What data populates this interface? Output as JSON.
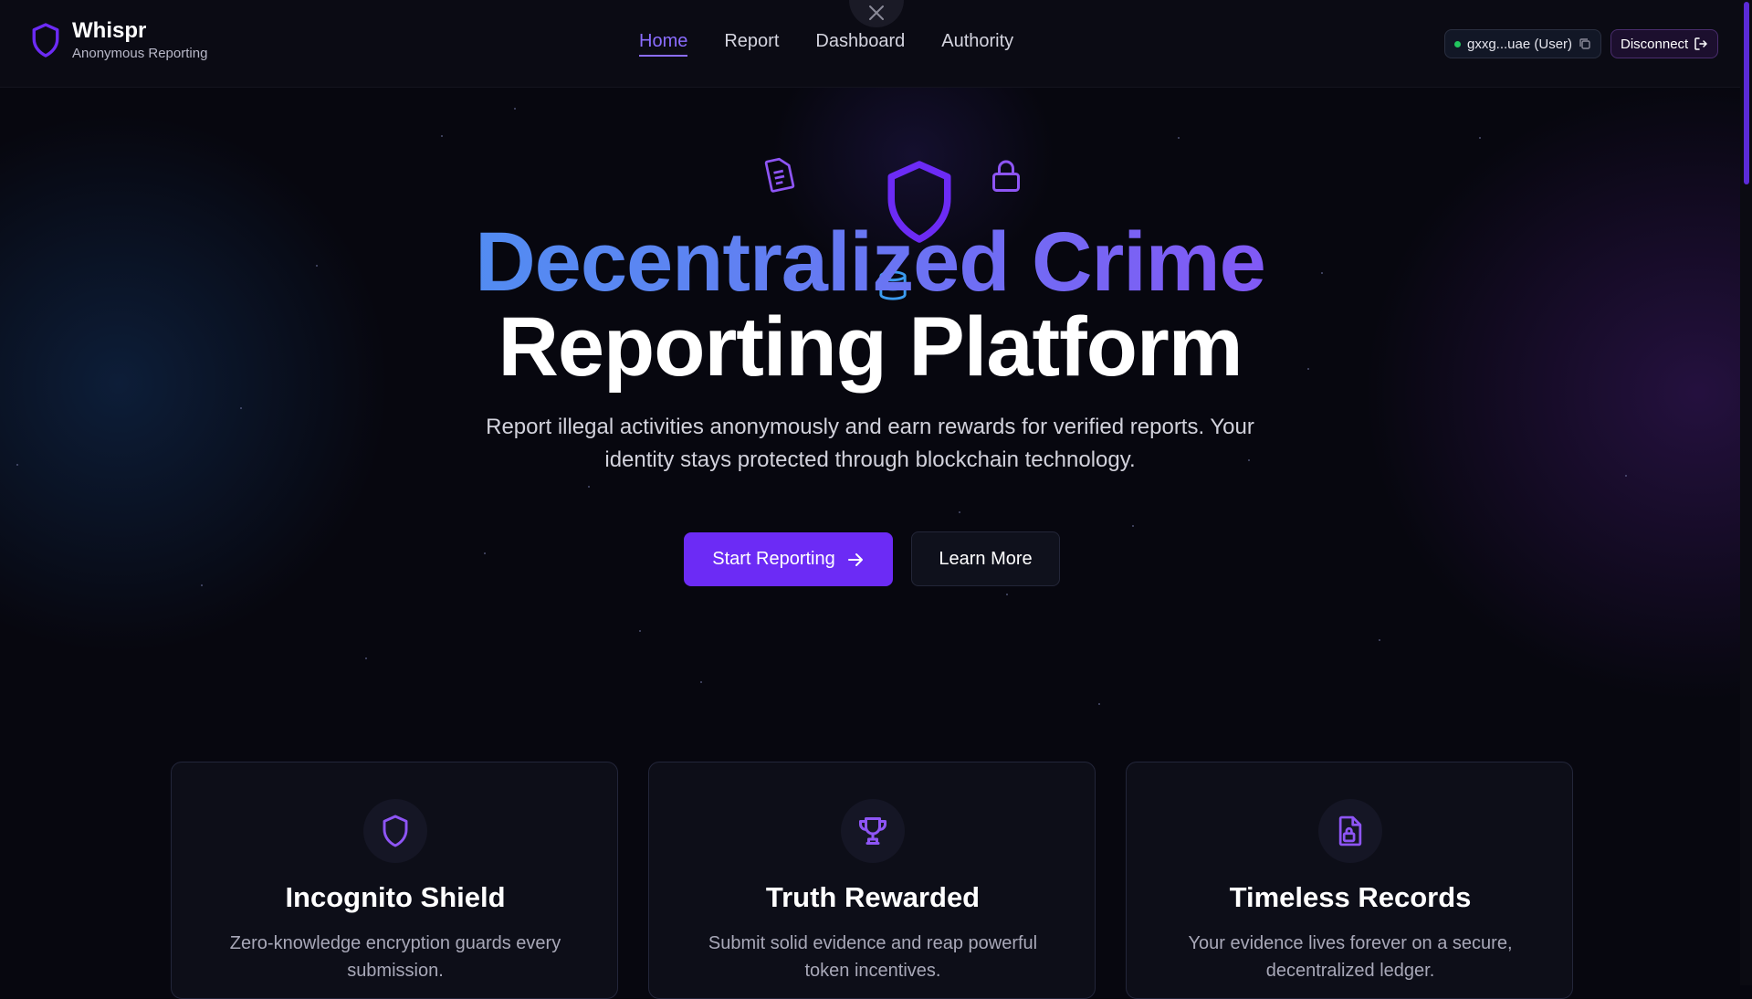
{
  "app": {
    "title": "Whispr",
    "subtitle": "Anonymous Reporting"
  },
  "nav": {
    "items": [
      "Home",
      "Report",
      "Dashboard",
      "Authority"
    ],
    "active": "Home"
  },
  "wallet": {
    "label": "gxxg...uae (User)",
    "status_color": "#22c55e"
  },
  "disconnect_label": "Disconnect",
  "hero": {
    "title_line1": "Decentralized Crime",
    "title_line2": "Reporting Platform",
    "subtitle": "Report illegal activities anonymously and earn rewards for verified reports. Your identity stays protected through blockchain technology.",
    "primary_button": "Start Reporting",
    "secondary_button": "Learn More",
    "floating_icons": [
      "document-icon",
      "shield-icon",
      "lock-icon",
      "database-icon"
    ]
  },
  "features": [
    {
      "icon": "shield-icon",
      "title": "Incognito Shield",
      "text": "Zero-knowledge encryption guards every submission."
    },
    {
      "icon": "trophy-icon",
      "title": "Truth Rewarded",
      "text": "Submit solid evidence and reap powerful token incentives."
    },
    {
      "icon": "file-lock-icon",
      "title": "Timeless Records",
      "text": "Your evidence lives forever on a secure, decentralized ledger."
    }
  ],
  "colors": {
    "accent": "#6c2bf5",
    "accent_light": "#8b6dff",
    "gradient_start": "#3b9cf0",
    "gradient_end": "#8e55f5",
    "background": "#07070f"
  }
}
